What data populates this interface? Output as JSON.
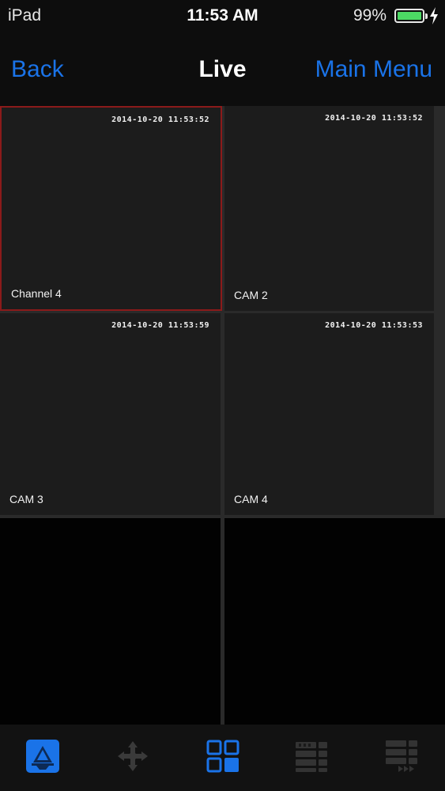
{
  "status_bar": {
    "carrier": "iPad",
    "time": "11:53 AM",
    "battery_percent": "99%",
    "battery_level": 0.99,
    "charging": true
  },
  "nav": {
    "back_label": "Back",
    "title": "Live",
    "main_menu_label": "Main Menu"
  },
  "grid": {
    "cells": [
      {
        "label": "Channel 4",
        "timestamp": "2014-10-20 11:53:52",
        "selected": true
      },
      {
        "label": "CAM 2",
        "timestamp": "2014-10-20 11:53:52",
        "selected": false
      },
      {
        "label": "CAM 3",
        "timestamp": "2014-10-20 11:53:59",
        "selected": false
      },
      {
        "label": "CAM 4",
        "timestamp": "2014-10-20 11:53:53",
        "selected": false
      },
      {
        "label": "",
        "timestamp": "",
        "selected": false
      },
      {
        "label": "",
        "timestamp": "",
        "selected": false
      }
    ]
  },
  "toolbar": {
    "items": [
      {
        "icon": "live-view-icon",
        "active": true
      },
      {
        "icon": "ptz-move-icon",
        "active": false
      },
      {
        "icon": "grid-layout-icon",
        "active": false
      },
      {
        "icon": "playback-rewind-icon",
        "active": false
      },
      {
        "icon": "playback-forward-icon",
        "active": false
      }
    ]
  },
  "colors": {
    "accent": "#1a73e8",
    "selected_border": "#8b1a1a",
    "battery": "#4cd964"
  }
}
